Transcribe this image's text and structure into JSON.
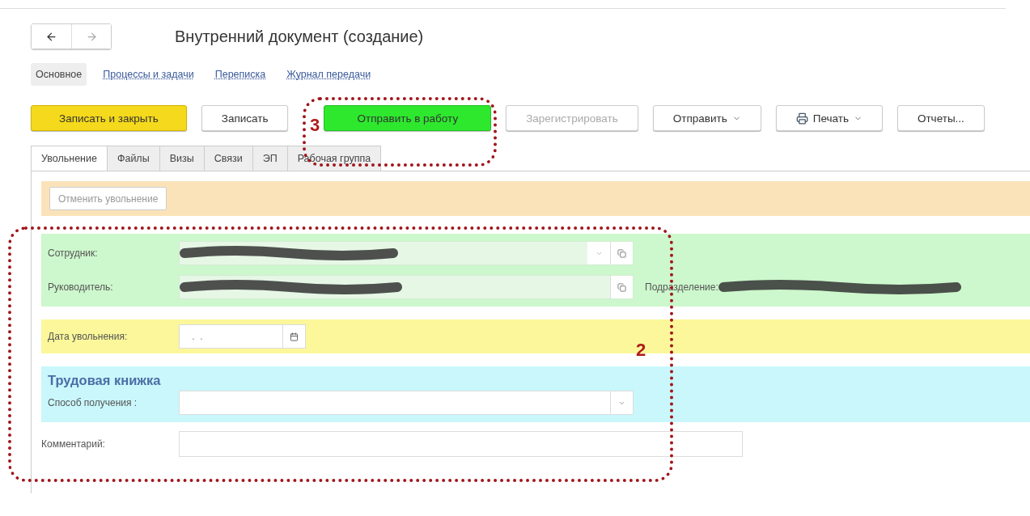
{
  "title": "Внутренний документ (создание)",
  "section_links": [
    {
      "label": "Основное",
      "selected": true
    },
    {
      "label": "Процессы и задачи",
      "selected": false
    },
    {
      "label": "Переписка",
      "selected": false
    },
    {
      "label": "Журнал передачи",
      "selected": false
    }
  ],
  "commands": [
    {
      "label": "Записать и закрыть",
      "kind": "primary",
      "disabled": false,
      "dropdown": false,
      "printer": false
    },
    {
      "label": "Записать",
      "kind": "default",
      "disabled": false,
      "dropdown": false,
      "printer": false
    },
    {
      "label": "Отправить в работу",
      "kind": "accent",
      "disabled": false,
      "dropdown": false,
      "printer": false
    },
    {
      "label": "Зарегистрировать",
      "kind": "default",
      "disabled": true,
      "dropdown": false,
      "printer": false
    },
    {
      "label": "Отправить",
      "kind": "default",
      "disabled": false,
      "dropdown": true,
      "printer": false
    },
    {
      "label": "Печать",
      "kind": "default",
      "disabled": false,
      "dropdown": true,
      "printer": true
    },
    {
      "label": "Отчеты...",
      "kind": "default",
      "disabled": false,
      "dropdown": false,
      "printer": false
    }
  ],
  "tabs": [
    {
      "label": "Увольнение",
      "selected": true
    },
    {
      "label": "Файлы",
      "selected": false
    },
    {
      "label": "Визы",
      "selected": false
    },
    {
      "label": "Связи",
      "selected": false
    },
    {
      "label": "ЭП",
      "selected": false
    },
    {
      "label": "Рабочая группа",
      "selected": false
    }
  ],
  "cancel_button": {
    "label": "Отменить увольнение",
    "disabled": true
  },
  "employee": {
    "label": "Сотрудник:",
    "redacted": true
  },
  "manager": {
    "label": "Руководитель:",
    "redacted": true
  },
  "department": {
    "label": "Подразделение:",
    "redacted": true
  },
  "dismissal_date": {
    "label": "Дата увольнения:",
    "value": " .  ."
  },
  "work_book": {
    "title": "Трудовая книжка",
    "field_label": "Способ получения :"
  },
  "comment": {
    "label": "Комментарий:"
  },
  "annotations": [
    {
      "number": "3"
    },
    {
      "number": "2"
    }
  ]
}
